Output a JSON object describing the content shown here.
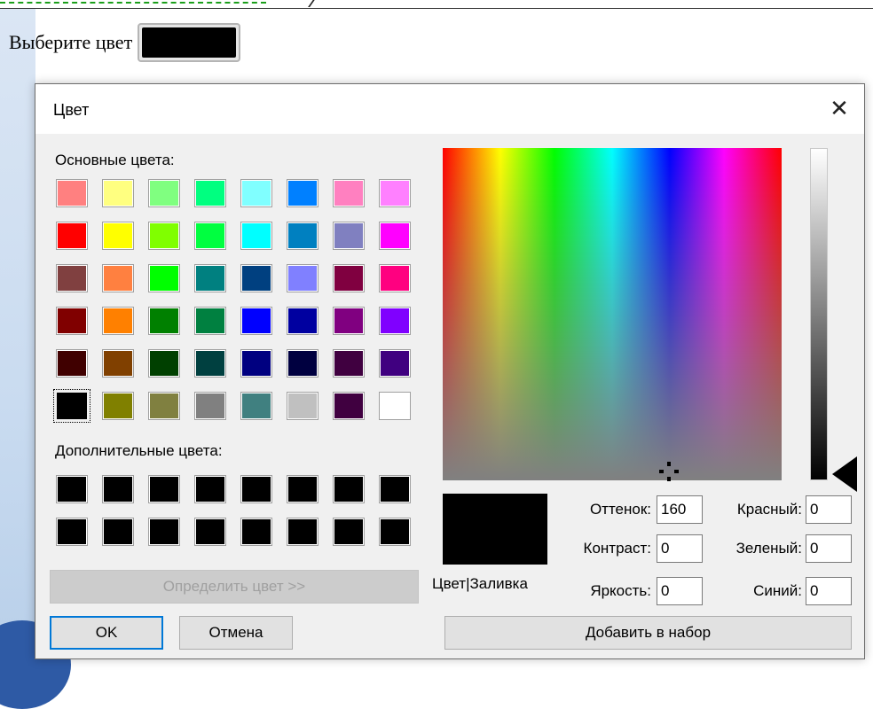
{
  "page": {
    "prompt_label": "Выберите цвет"
  },
  "dialog": {
    "title": "Цвет",
    "basic_colors_label": "Основные цвета:",
    "custom_colors_label": "Дополнительные цвета:",
    "define_button": "Определить цвет >>",
    "ok_button": "OK",
    "cancel_button": "Отмена",
    "add_button": "Добавить в набор",
    "preview_label": "Цвет|Заливка",
    "hue_label": "Оттенок:",
    "sat_label": "Контраст:",
    "lum_label": "Яркость:",
    "red_label": "Красный:",
    "green_label": "Зеленый:",
    "blue_label": "Синий:",
    "hue": "160",
    "sat": "0",
    "lum": "0",
    "red": "0",
    "green": "0",
    "blue": "0",
    "close_icon": "close-icon"
  },
  "basic_colors": [
    "#ff8080",
    "#ffff80",
    "#80ff80",
    "#00ff80",
    "#80ffff",
    "#0080ff",
    "#ff80c0",
    "#ff80ff",
    "#ff0000",
    "#ffff00",
    "#80ff00",
    "#00ff40",
    "#00ffff",
    "#0080c0",
    "#8080c0",
    "#ff00ff",
    "#804040",
    "#ff8040",
    "#00ff00",
    "#008080",
    "#004080",
    "#8080ff",
    "#800040",
    "#ff0080",
    "#800000",
    "#ff8000",
    "#008000",
    "#008040",
    "#0000ff",
    "#0000a0",
    "#800080",
    "#8000ff",
    "#400000",
    "#804000",
    "#004000",
    "#004040",
    "#000080",
    "#000040",
    "#400040",
    "#400080",
    "#000000",
    "#808000",
    "#808040",
    "#808080",
    "#408080",
    "#c0c0c0",
    "#400040",
    "#ffffff"
  ],
  "selected_basic_index": 40,
  "custom_colors": [
    "#000000",
    "#000000",
    "#000000",
    "#000000",
    "#000000",
    "#000000",
    "#000000",
    "#000000",
    "#000000",
    "#000000",
    "#000000",
    "#000000",
    "#000000",
    "#000000",
    "#000000",
    "#000000"
  ]
}
